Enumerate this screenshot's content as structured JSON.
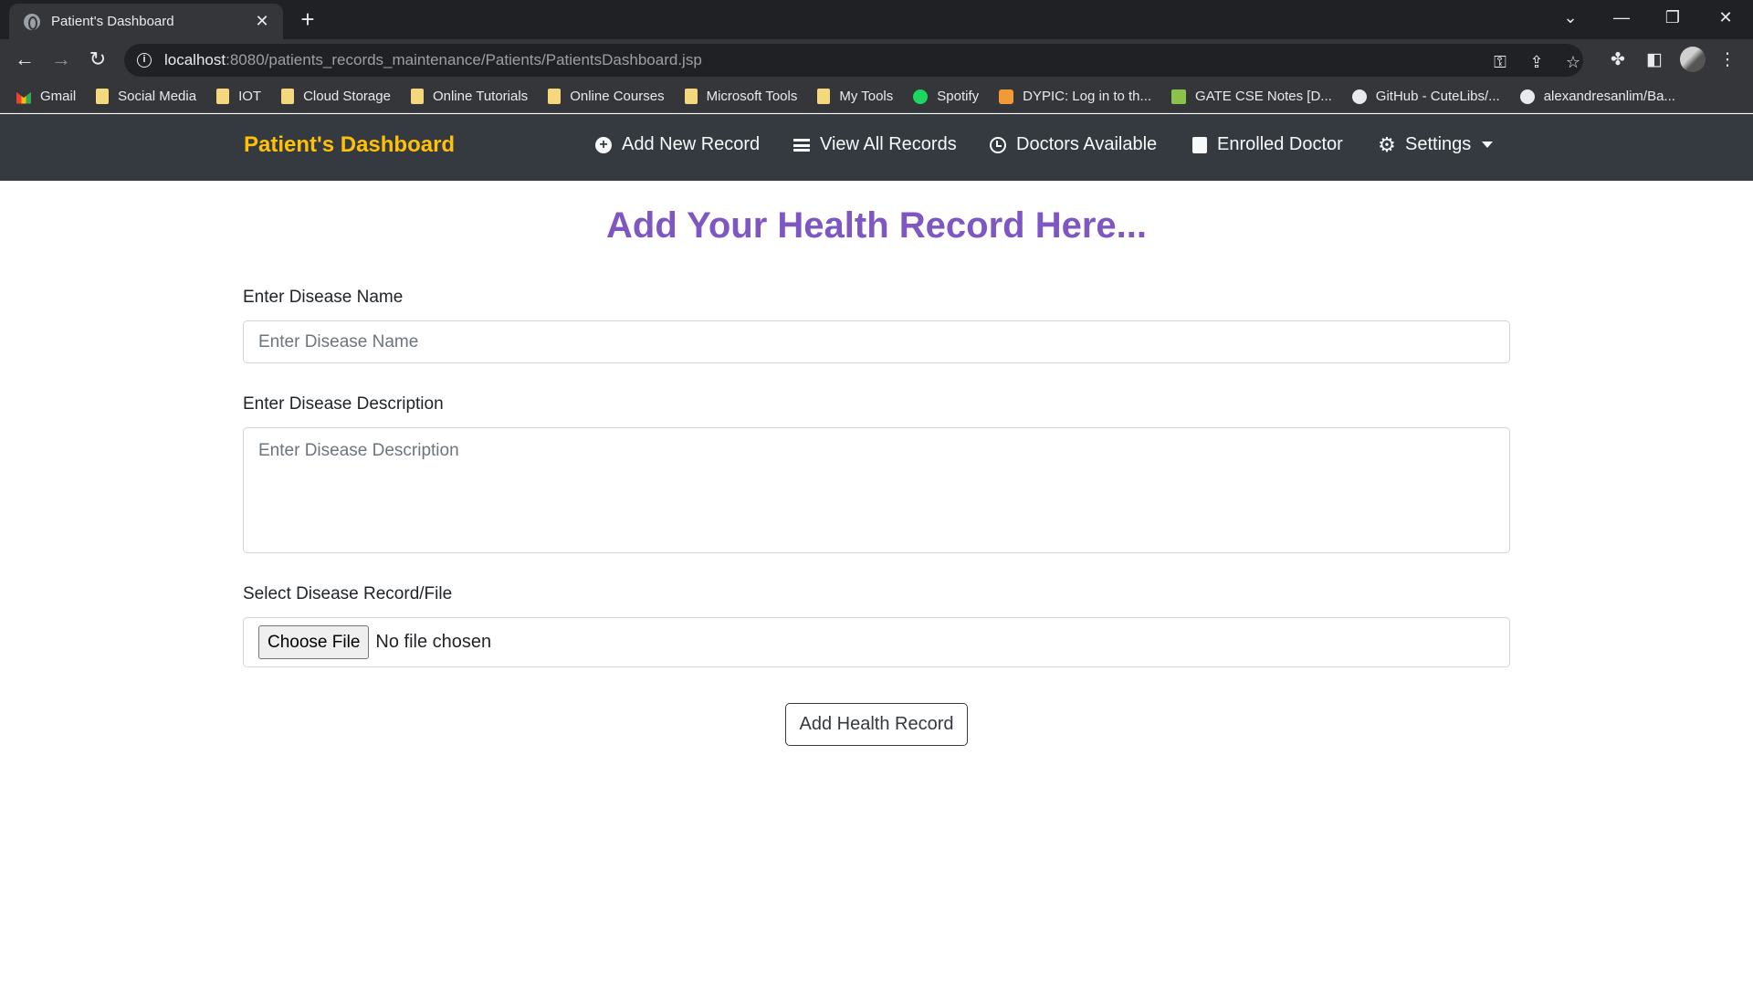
{
  "browser": {
    "tab_title": "Patient's Dashboard",
    "tab_close": "✕",
    "new_tab": "+",
    "url_host": "localhost",
    "url_rest": ":8080/patients_records_maintenance/Patients/PatientsDashboard.jsp",
    "window_controls": [
      "⌄",
      "—",
      "❐",
      "✕"
    ],
    "bookmarks": [
      {
        "label": "Gmail",
        "icon": "gmail-icon"
      },
      {
        "label": "Social Media",
        "icon": "folder-icon"
      },
      {
        "label": "IOT",
        "icon": "folder-icon"
      },
      {
        "label": "Cloud Storage",
        "icon": "folder-icon"
      },
      {
        "label": "Online Tutorials",
        "icon": "folder-icon"
      },
      {
        "label": "Online Courses",
        "icon": "folder-icon"
      },
      {
        "label": "Microsoft Tools",
        "icon": "folder-icon"
      },
      {
        "label": "My Tools",
        "icon": "folder-icon"
      },
      {
        "label": "Spotify",
        "icon": "spotify-icon"
      },
      {
        "label": "DYPIC: Log in to th...",
        "icon": "dypic-icon"
      },
      {
        "label": "GATE CSE Notes [D...",
        "icon": "gate-icon"
      },
      {
        "label": "GitHub - CuteLibs/...",
        "icon": "github-icon"
      },
      {
        "label": "alexandresanlim/Ba...",
        "icon": "github-icon"
      }
    ]
  },
  "navbar": {
    "brand": "Patient's Dashboard",
    "links": [
      {
        "label": "Add New Record",
        "icon": "plus-circle-icon"
      },
      {
        "label": "View All Records",
        "icon": "list-icon"
      },
      {
        "label": "Doctors Available",
        "icon": "clock-icon"
      },
      {
        "label": "Enrolled Doctor",
        "icon": "book-icon"
      },
      {
        "label": "Settings",
        "icon": "gear-icon"
      }
    ]
  },
  "form": {
    "heading": "Add Your Health Record Here...",
    "disease_name_label": "Enter Disease Name",
    "disease_name_placeholder": "Enter Disease Name",
    "disease_desc_label": "Enter Disease Description",
    "disease_desc_placeholder": "Enter Disease Description",
    "file_label": "Select Disease Record/File",
    "choose_file": "Choose File",
    "no_file": "No file chosen",
    "submit": "Add Health Record"
  },
  "colors": {
    "navbar_bg": "#343a40",
    "brand": "#ffc107",
    "heading": "#7e57c2"
  }
}
